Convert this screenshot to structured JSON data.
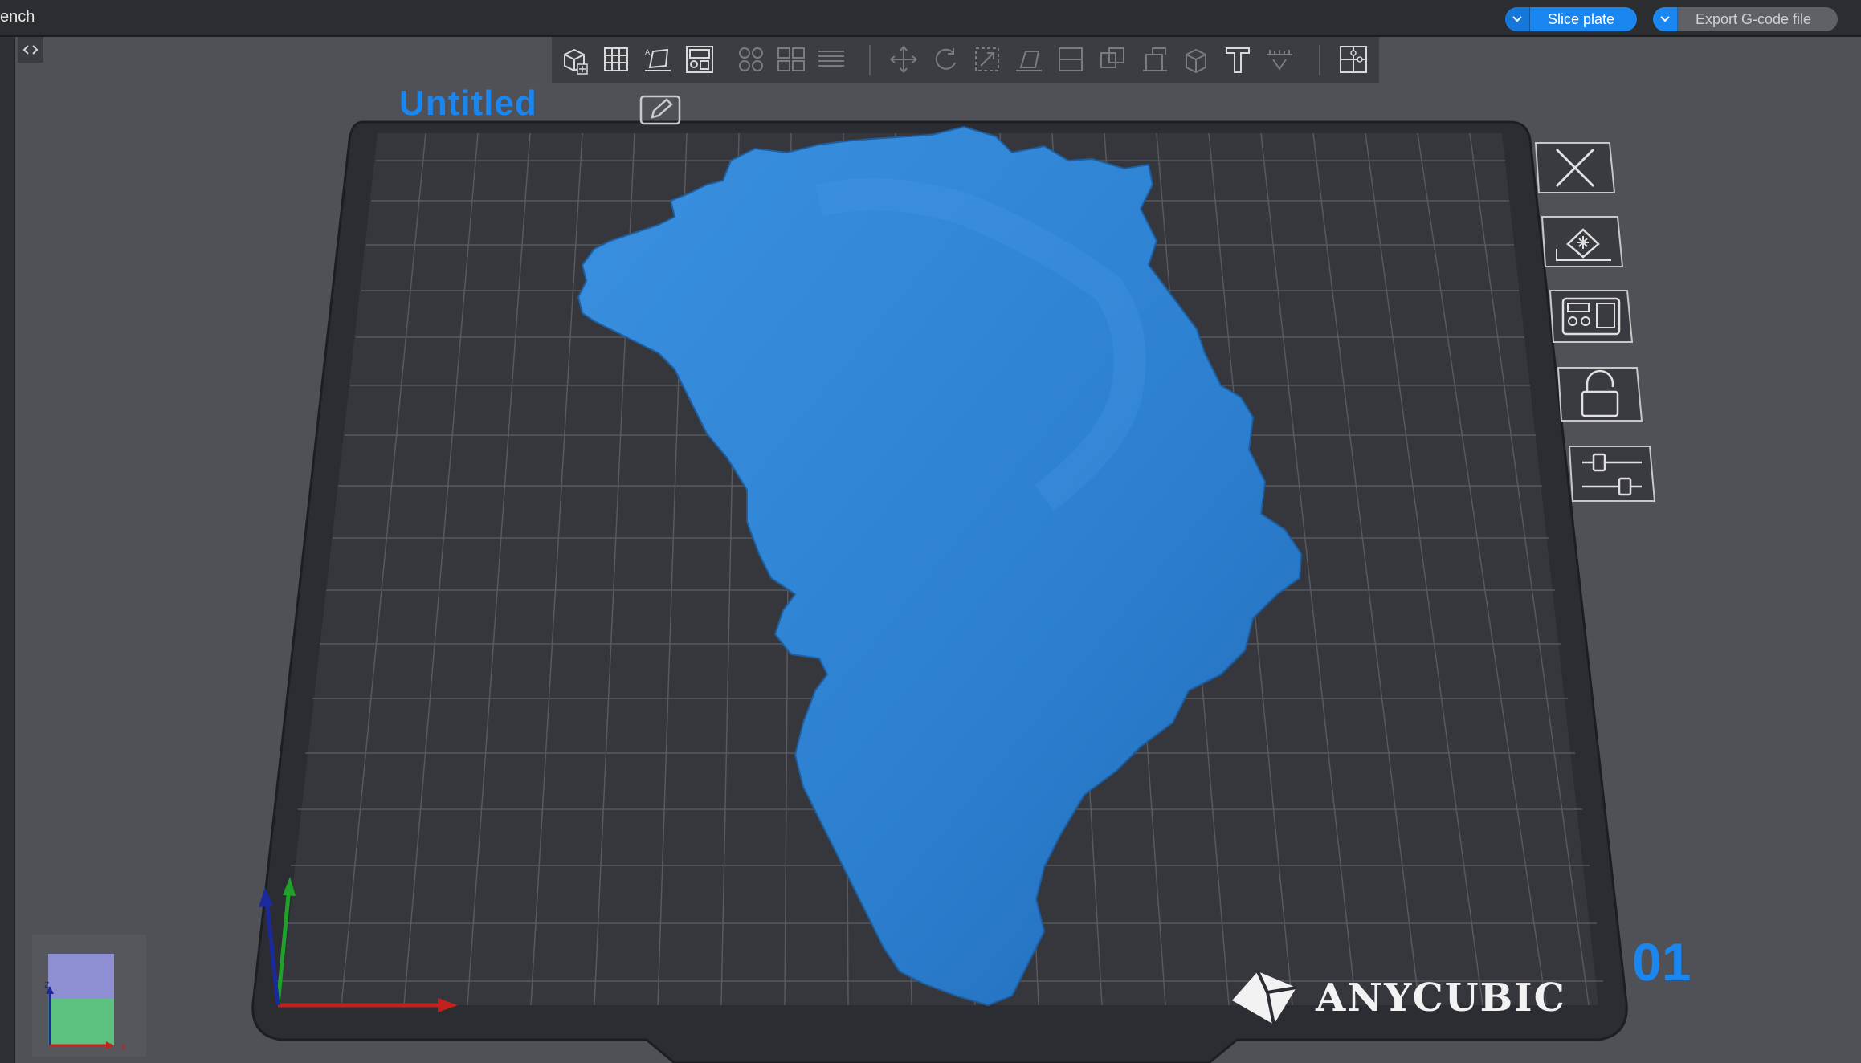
{
  "window": {
    "title": "ench"
  },
  "top_actions": {
    "slice_label": "Slice plate",
    "export_label": "Export G-code file"
  },
  "project": {
    "title": "Untitled"
  },
  "plate": {
    "number": "01",
    "brand": "ANYCUBIC"
  },
  "toolbar": {
    "icons": [
      "add-object-icon",
      "grid-plate-icon",
      "auto-orient-icon",
      "arrange-icon",
      "instances-icon",
      "split-icon",
      "layers-icon",
      "move-icon",
      "rotate-icon",
      "scale-icon",
      "lay-on-face-icon",
      "cut-icon",
      "boolean-icon",
      "supports-icon",
      "seam-icon",
      "text-icon",
      "measure-icon",
      "assembly-icon"
    ]
  },
  "side_buttons": [
    "close-icon",
    "orient-plate-icon",
    "arrange-plate-icon",
    "lock-icon",
    "plate-settings-icon"
  ],
  "colors": {
    "accent": "#1a86f0",
    "plate": "#2c2d32",
    "model": "#2f83d4",
    "background": "#4f5157"
  }
}
